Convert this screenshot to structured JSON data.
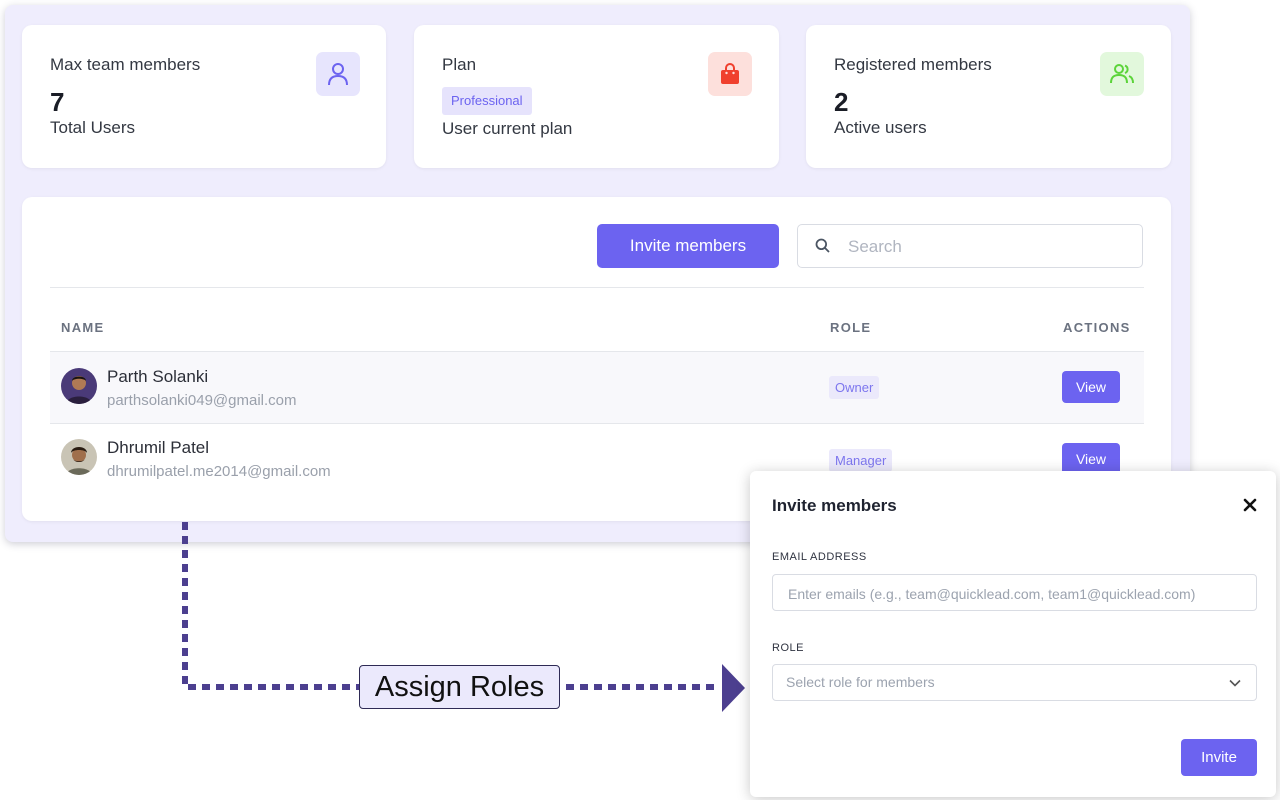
{
  "stats": [
    {
      "label": "Max team members",
      "value": "7",
      "sub": "Total Users",
      "icon": "user-icon",
      "icon_bg": "#e7e5fd",
      "icon_color": "#6c63f0"
    },
    {
      "label": "Plan",
      "badge": "Professional",
      "sub": "User current plan",
      "icon": "shopping-bag-icon",
      "icon_bg": "#fde0dc",
      "icon_color": "#f0402e"
    },
    {
      "label": "Registered members",
      "value": "2",
      "sub": "Active users",
      "icon": "users-icon",
      "icon_bg": "#e2f8dc",
      "icon_color": "#5cd43a"
    }
  ],
  "toolbar": {
    "invite_label": "Invite members",
    "search_placeholder": "Search"
  },
  "table": {
    "columns": [
      "NAME",
      "ROLE",
      "ACTIONS"
    ],
    "rows": [
      {
        "name": "Parth Solanki",
        "email": "parthsolanki049@gmail.com",
        "role": "Owner",
        "action": "View"
      },
      {
        "name": "Dhrumil Patel",
        "email": "dhrumilpatel.me2014@gmail.com",
        "role": "Manager",
        "action": "View"
      }
    ]
  },
  "modal": {
    "title": "Invite members",
    "email_label": "EMAIL ADDRESS",
    "email_placeholder": "Enter emails (e.g., team@quicklead.com, team1@quicklead.com)",
    "role_label": "ROLE",
    "role_placeholder": "Select role for members",
    "submit_label": "Invite"
  },
  "annotation": {
    "label": "Assign Roles",
    "color": "#4c3f8f"
  }
}
